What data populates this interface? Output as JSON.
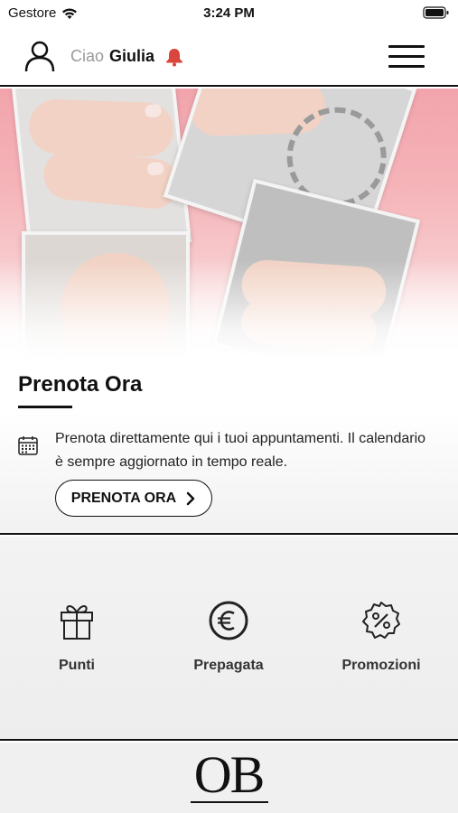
{
  "status_bar": {
    "carrier": "Gestore",
    "time": "3:24 PM"
  },
  "header": {
    "greeting_prefix": "Ciao",
    "user_name": "Giulia",
    "accent_color": "#c0392b"
  },
  "booking": {
    "title": "Prenota Ora",
    "description": "Prenota direttamente qui i tuoi appuntamenti. Il calendario è sempre aggiornato in tempo reale.",
    "button_label": "PRENOTA ORA"
  },
  "features": [
    {
      "label": "Punti",
      "icon": "gift-icon"
    },
    {
      "label": "Prepagata",
      "icon": "euro-icon"
    },
    {
      "label": "Promozioni",
      "icon": "discount-badge-icon"
    }
  ],
  "footer": {
    "logo_text": "OB"
  }
}
